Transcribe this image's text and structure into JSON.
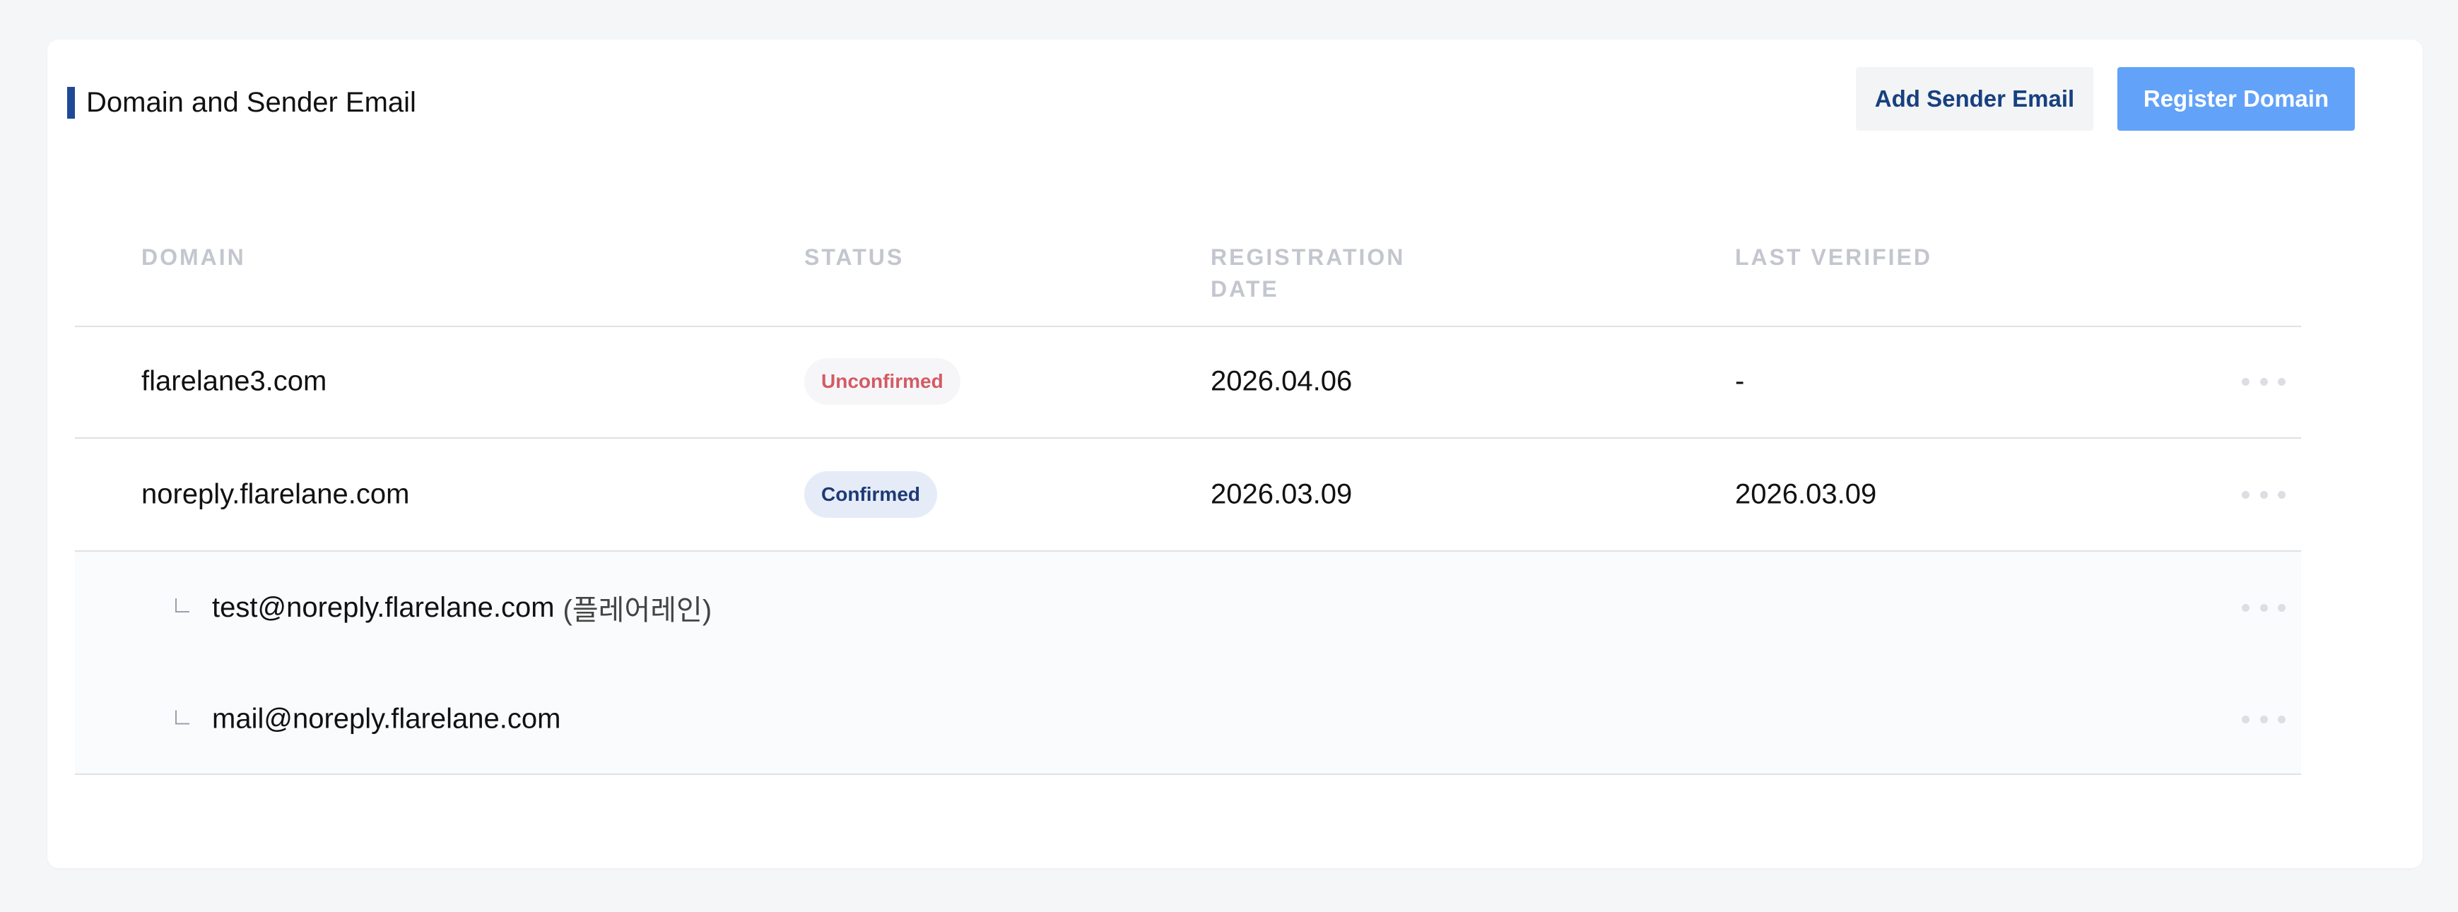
{
  "header": {
    "title": "Domain and Sender Email",
    "add_sender_label": "Add Sender Email",
    "register_domain_label": "Register Domain"
  },
  "table": {
    "columns": [
      "DOMAIN",
      "STATUS",
      "REGISTRATION DATE",
      "LAST VERIFIED"
    ],
    "rows": [
      {
        "domain": "flarelane3.com",
        "status": "Unconfirmed",
        "registration_date": "2026.04.06",
        "last_verified": "-"
      },
      {
        "domain": "noreply.flarelane.com",
        "status": "Confirmed",
        "registration_date": "2026.03.09",
        "last_verified": "2026.03.09",
        "senders": [
          {
            "email": "test@noreply.flarelane.com",
            "name": "(플레어레인)"
          },
          {
            "email": "mail@noreply.flarelane.com",
            "name": ""
          }
        ]
      }
    ]
  },
  "colors": {
    "accent": "#1f4896",
    "primary_button": "#62a2f9",
    "unconfirmed": "#d55a63",
    "confirmed": "#1e3a75"
  },
  "icons": {
    "more": "more-horizontal-icon",
    "branch": "tree-branch-icon"
  }
}
